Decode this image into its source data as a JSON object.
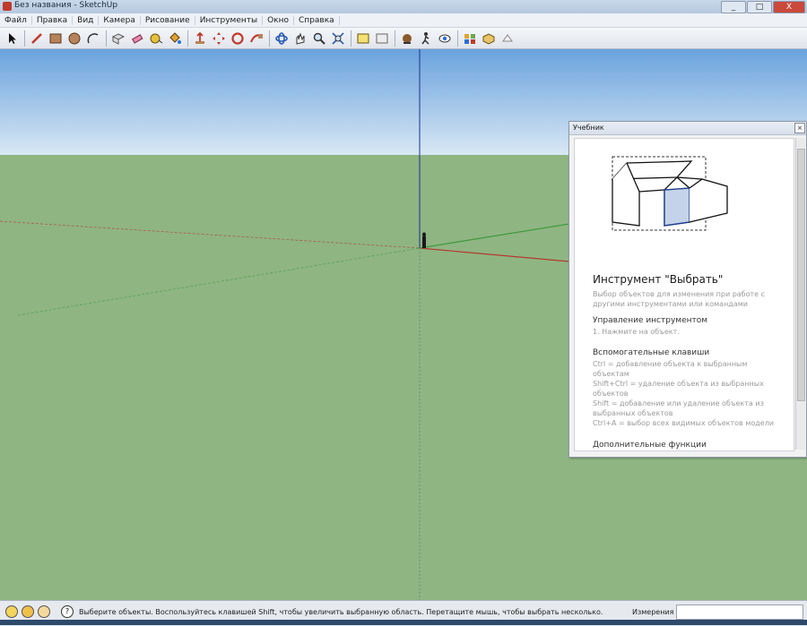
{
  "window": {
    "title": "Без названия - SketchUp",
    "buttons": [
      "_",
      "□",
      "X"
    ]
  },
  "menu": [
    "Файл",
    "Правка",
    "Вид",
    "Камера",
    "Рисование",
    "Инструменты",
    "Окно",
    "Справка"
  ],
  "toolbar": {
    "icons": [
      "select-icon",
      "line-icon",
      "rectangle-icon",
      "circle-icon",
      "arc-icon",
      "make-component-icon",
      "eraser-icon",
      "tape-measure-icon",
      "paint-bucket-icon",
      "push-pull-icon",
      "move-icon",
      "rotate-icon",
      "follow-me-icon",
      "orbit-icon",
      "pan-icon",
      "zoom-icon",
      "zoom-extents-icon",
      "previous-view-icon",
      "next-view-icon",
      "top-view-icon",
      "walk-icon",
      "look-around-icon",
      "position-camera-icon",
      "section-plane-icon",
      "get-models-icon",
      "share-model-icon",
      "photo-textures-icon"
    ]
  },
  "colors": {
    "sky_top": "#6aa2dd",
    "sky_bottom": "#d8e8f4",
    "ground": "#8fb583",
    "axis_red": "#b33a2f",
    "axis_green": "#3f9a3c",
    "axis_blue": "#1f2f8c"
  },
  "instructor": {
    "panel_title": "Учебник",
    "tool_title": "Инструмент \"Выбрать\"",
    "tool_desc": "Выбор объектов для изменения при работе с другими инструментами или командами",
    "section1_title": "Управление инструментом",
    "section1_items": [
      "1. Нажмите на объект."
    ],
    "section2_title": "Вспомогательные клавиши",
    "section2_items": [
      "Ctrl = добавление объекта к выбранным объектам",
      "Shift+Ctrl = удаление объекта из выбранных объектов",
      "Shift = добавление или удаление объекта из выбранных объектов",
      "Ctrl+A = выбор всех видимых объектов модели"
    ],
    "section3_title": "Дополнительные функции"
  },
  "status": {
    "text": "Выберите объекты. Воспользуйтесь клавишей Shift, чтобы увеличить выбранную область. Перетащите мышь, чтобы выбрать несколько.",
    "measurement_label": "Измерения",
    "measurement_value": ""
  }
}
